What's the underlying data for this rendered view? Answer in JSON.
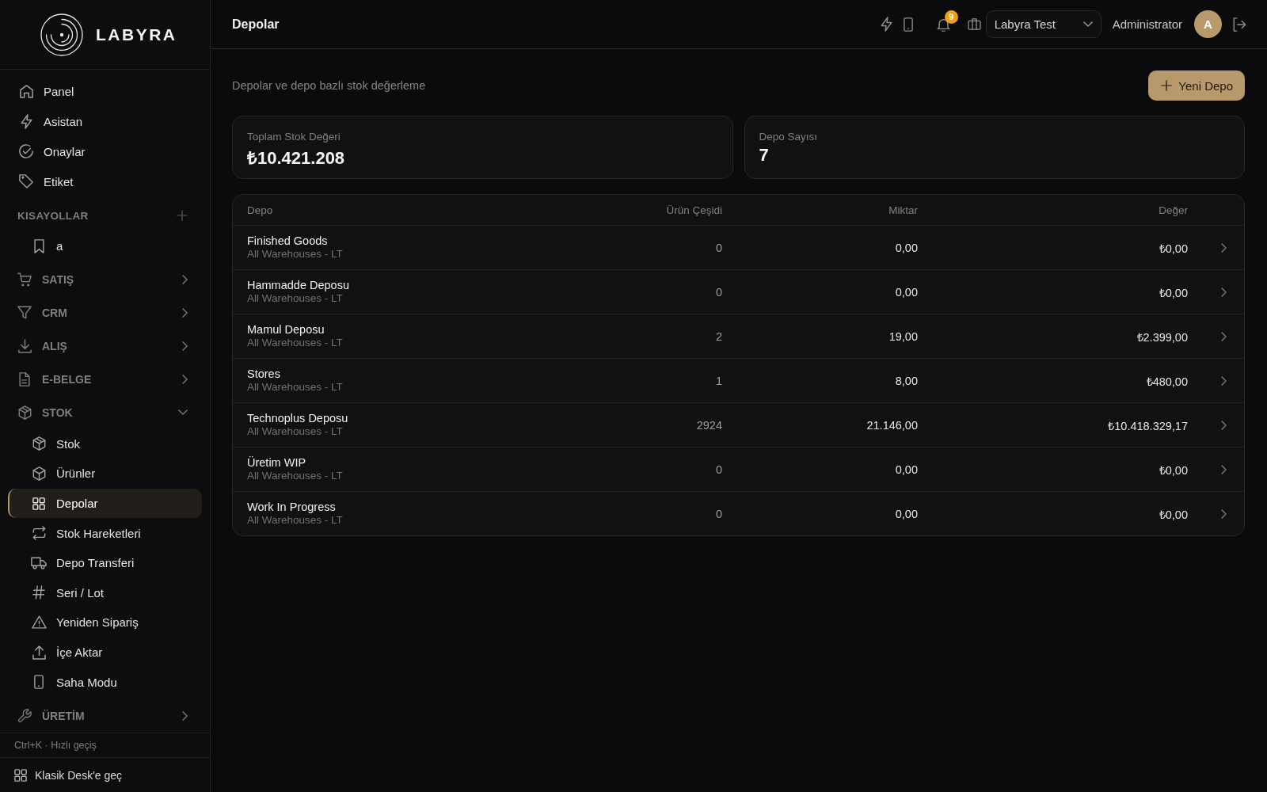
{
  "sidebar": {
    "brand": "LABYRA",
    "nav": [
      {
        "label": "Panel",
        "selected": false
      },
      {
        "label": "Asistan",
        "selected": false
      },
      {
        "label": "Onaylar",
        "selected": false
      },
      {
        "label": "Etiket",
        "selected": false
      }
    ],
    "shortcuts": {
      "title": "KISAYOLLAR",
      "items": [
        {
          "label": "a",
          "selected": false
        }
      ]
    },
    "sections": [
      {
        "label": "SATIŞ",
        "expanded": false
      },
      {
        "label": "CRM",
        "expanded": false
      },
      {
        "label": "ALIŞ",
        "expanded": false
      },
      {
        "label": "E-BELGE",
        "expanded": false
      },
      {
        "label": "STOK",
        "expanded": true,
        "children": [
          {
            "label": "Stok",
            "selected": false
          },
          {
            "label": "Ürünler",
            "selected": false
          },
          {
            "label": "Depolar",
            "selected": true
          },
          {
            "label": "Stok Hareketleri",
            "selected": false
          },
          {
            "label": "Depo Transferi",
            "selected": false
          },
          {
            "label": "Seri / Lot",
            "selected": false
          },
          {
            "label": "Yeniden Sipariş",
            "selected": false
          },
          {
            "label": "İçe Aktar",
            "selected": false
          },
          {
            "label": "Saha Modu",
            "selected": false
          }
        ]
      },
      {
        "label": "ÜRETİM",
        "expanded": false
      }
    ],
    "footer_hint": "Ctrl+K · Hızlı geçiş",
    "classic_link": "Klasik Desk'e geç"
  },
  "topbar": {
    "title": "Depolar",
    "notifications": "9",
    "company": "Labyra Test",
    "user": "Administrator",
    "avatar": "A"
  },
  "page": {
    "subtitle": "Depolar ve depo bazlı stok değerleme",
    "new_button": "Yeni Depo",
    "stats": [
      {
        "label": "Toplam Stok Değeri",
        "value": "₺10.421.208"
      },
      {
        "label": "Depo Sayısı",
        "value": "7"
      }
    ],
    "table": {
      "columns": [
        "Depo",
        "Ürün Çeşidi",
        "Miktar",
        "Değer"
      ],
      "rows": [
        {
          "name": "Finished Goods",
          "location": "All Warehouses - LT",
          "products": "0",
          "quantity": "0,00",
          "value": "₺0,00"
        },
        {
          "name": "Hammadde Deposu",
          "location": "All Warehouses - LT",
          "products": "0",
          "quantity": "0,00",
          "value": "₺0,00"
        },
        {
          "name": "Mamul Deposu",
          "location": "All Warehouses - LT",
          "products": "2",
          "quantity": "19,00",
          "value": "₺2.399,00"
        },
        {
          "name": "Stores",
          "location": "All Warehouses - LT",
          "products": "1",
          "quantity": "8,00",
          "value": "₺480,00"
        },
        {
          "name": "Technoplus Deposu",
          "location": "All Warehouses - LT",
          "products": "2924",
          "quantity": "21.146,00",
          "value": "₺10.418.329,17"
        },
        {
          "name": "Üretim WIP",
          "location": "All Warehouses - LT",
          "products": "0",
          "quantity": "0,00",
          "value": "₺0,00"
        },
        {
          "name": "Work In Progress",
          "location": "All Warehouses - LT",
          "products": "0",
          "quantity": "0,00",
          "value": "₺0,00"
        }
      ]
    }
  }
}
